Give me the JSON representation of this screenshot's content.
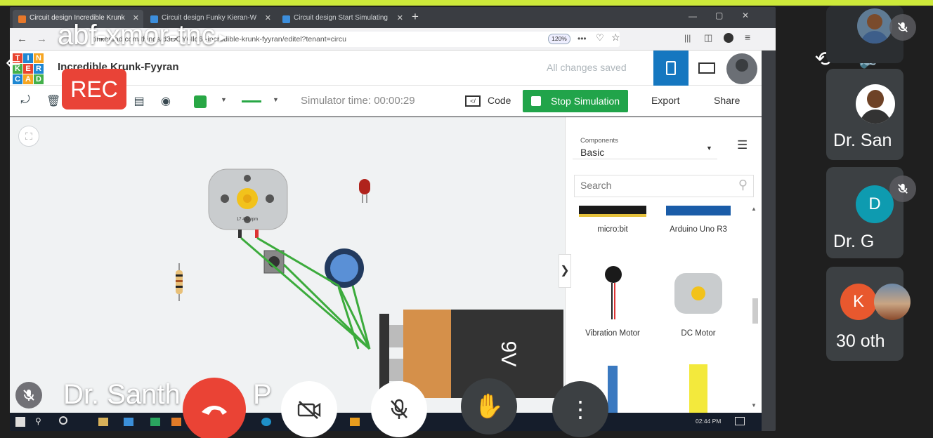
{
  "browser": {
    "tabs": [
      {
        "label": "Circuit design Incredible Krunk",
        "active": true
      },
      {
        "label": "Circuit design Funky Kieran-W",
        "active": false
      },
      {
        "label": "Circuit design Start Simulating",
        "active": false
      }
    ],
    "url": "tinkercad.com/things/d3DOY6Ild6r-incredible-krunk-fyyran/editel?tenant=circu",
    "zoom": "120%"
  },
  "tinkercad": {
    "logo_letters": [
      "T",
      "I",
      "N",
      "K",
      "E",
      "R",
      "C",
      "A",
      "D"
    ],
    "project_title": "Incredible Krunk-Fyyran",
    "save_status": "All changes saved",
    "simulator_time": "Simulator time: 00:00:29",
    "code_label": "Code",
    "stop_label": "Stop Simulation",
    "export_label": "Export",
    "share_label": "Share",
    "components_heading": "Components",
    "components_category": "Basic",
    "search_placeholder": "Search",
    "components": [
      "micro:bit",
      "Arduino Uno R3",
      "Vibration Motor",
      "DC Motor"
    ],
    "motor_rpm": "17 432 rpm",
    "battery_label": "9V",
    "taskbar_time": "02:44 PM"
  },
  "meeting": {
    "code": "abf-xmor-tnc",
    "rec_label": "REC",
    "presenter_name": "Dr. Santh",
    "presenter_suffix": "P",
    "tiles": [
      {
        "name": "Dr. San",
        "muted": false
      },
      {
        "name": "Dr. G",
        "initial": "D",
        "muted": true
      },
      {
        "name": "30 oth",
        "initial": "K"
      }
    ]
  },
  "colors": {
    "accent": "#cde93a",
    "stop_green": "#21a44a",
    "end_call": "#ea4335"
  },
  "icons": [
    "rotate-camera-icon",
    "volume-icon",
    "mic-off-icon",
    "camera-off-icon",
    "raise-hand-icon",
    "more-icon",
    "end-call-icon"
  ]
}
